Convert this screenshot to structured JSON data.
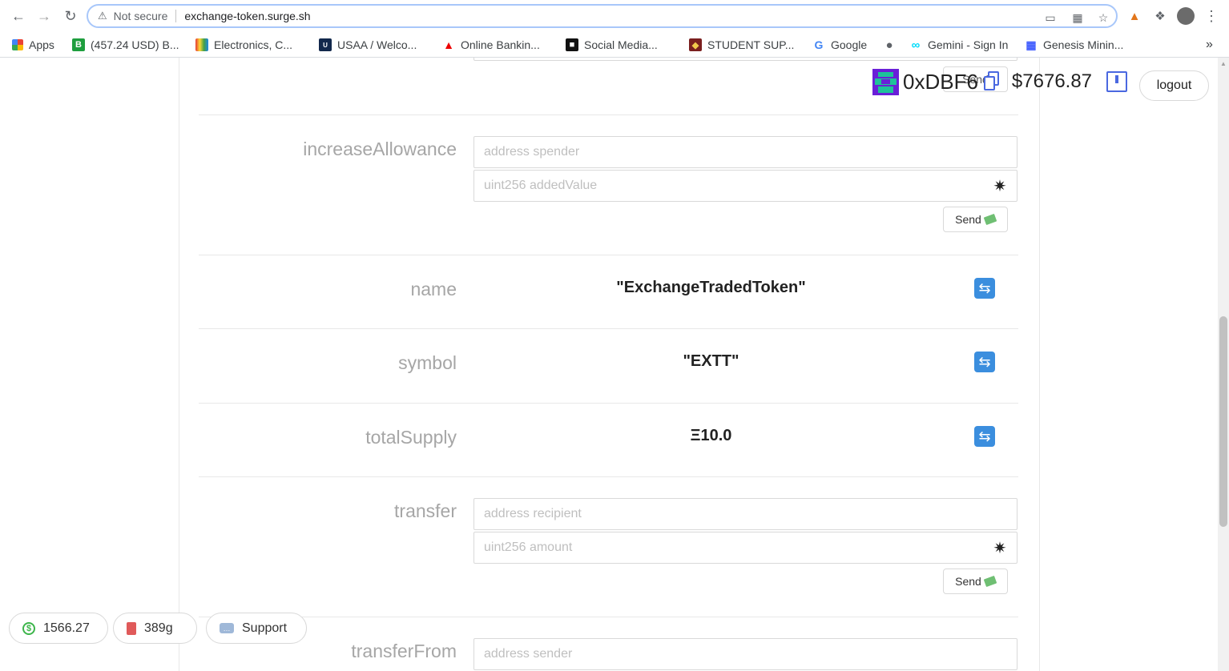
{
  "browser": {
    "security_label": "Not secure",
    "url": "exchange-token.surge.sh",
    "bookmarks": [
      {
        "label": "Apps"
      },
      {
        "label": "(457.24 USD) B..."
      },
      {
        "label": "Electronics, C..."
      },
      {
        "label": "USAA / Welco..."
      },
      {
        "label": "Online Bankin..."
      },
      {
        "label": "Social Media..."
      },
      {
        "label": "STUDENT SUP..."
      },
      {
        "label": "Google"
      },
      {
        "label": ""
      },
      {
        "label": "Gemini - Sign In"
      },
      {
        "label": "Genesis Minin..."
      }
    ],
    "bookmarks_overflow": "»"
  },
  "account": {
    "address": "0xDBF6",
    "balance": "$7676.87",
    "logout_label": "logout",
    "partial_send_label": "Send"
  },
  "functions": {
    "increaseAllowance": {
      "label": "increaseAllowance",
      "inputs": [
        {
          "placeholder": "address spender"
        },
        {
          "placeholder": "uint256 addedValue"
        }
      ],
      "send_label": "Send"
    },
    "name": {
      "label": "name",
      "value": "\"ExchangeTradedToken\""
    },
    "symbol": {
      "label": "symbol",
      "value": "\"EXTT\""
    },
    "totalSupply": {
      "label": "totalSupply",
      "value": "Ξ10.0"
    },
    "transfer": {
      "label": "transfer",
      "inputs": [
        {
          "placeholder": "address recipient"
        },
        {
          "placeholder": "uint256 amount"
        }
      ],
      "send_label": "Send"
    },
    "transferFrom": {
      "label": "transferFrom",
      "inputs": [
        {
          "placeholder": "address sender"
        }
      ]
    }
  },
  "footer": {
    "price": "1566.27",
    "gas": "389g",
    "support_label": "Support"
  },
  "colors": {
    "accent_blue": "#3b8ede",
    "label_gray": "#a6a6a6",
    "placeholder_gray": "#bfbfbf",
    "blockie_purple": "#6a1fd8",
    "blockie_green": "#1ec29a"
  }
}
